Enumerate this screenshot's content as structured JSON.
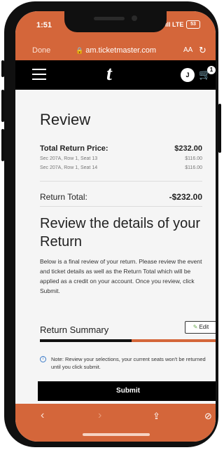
{
  "status": {
    "time": "1:51",
    "signal": "ıll LTE",
    "battery": "53"
  },
  "browser": {
    "done_label": "Done",
    "url": "am.ticketmaster.com",
    "aa_label": "AA",
    "reload_icon": "reload-icon"
  },
  "app": {
    "logo": "t",
    "avatar_initial": "J",
    "cart_count": "1"
  },
  "review": {
    "title": "Review",
    "total_label": "Total Return Price:",
    "total_value": "$232.00",
    "seats": [
      {
        "label": "Sec 207A, Row 1, Seat 13",
        "price": "$116.00"
      },
      {
        "label": "Sec 207A, Row 1, Seat 14",
        "price": "$116.00"
      }
    ],
    "return_total_label": "Return Total:",
    "return_total_value": "-$232.00"
  },
  "details": {
    "heading": "Review the details of your Return",
    "body": "Below is a final review of your return. Please review the event and ticket details as well as the Return Total which will be applied as a credit on your account. Once you review, click Submit."
  },
  "summary": {
    "title": "Return Summary",
    "edit_label": "Edit",
    "progress_fraction": 0.52,
    "note": "Note: Review your selections, your current seats won't be returned until you click submit.",
    "submit_label": "Submit"
  },
  "colors": {
    "accent": "#d4663a",
    "dark": "#000000",
    "background": "#f5f5f5"
  }
}
